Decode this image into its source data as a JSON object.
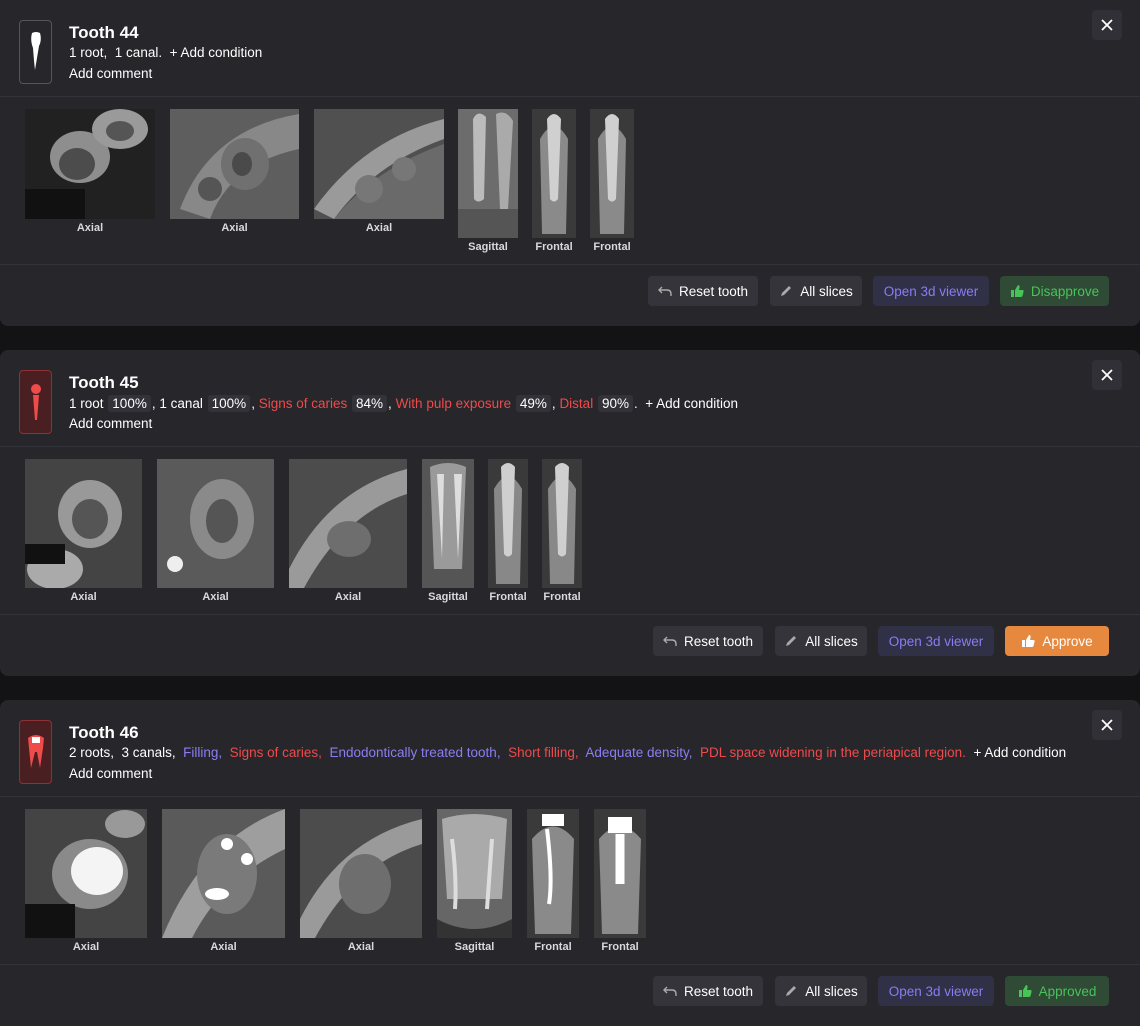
{
  "teeth": [
    {
      "title": "Tooth 44",
      "conditions_prefix": [
        {
          "text": "1 root,",
          "color": "white"
        },
        {
          "text": "1 canal.",
          "color": "white"
        }
      ],
      "add_condition": "+ Add condition",
      "add_comment": "Add comment",
      "slice_labels": [
        "Axial",
        "Axial",
        "Axial",
        "Sagittal",
        "Frontal",
        "Frontal"
      ],
      "buttons": {
        "reset": "Reset tooth",
        "all_slices": "All slices",
        "viewer": "Open 3d viewer",
        "status": "Disapprove"
      }
    },
    {
      "title": "Tooth 45",
      "conditions": [
        {
          "text": "1 root",
          "pct": "100%",
          "color": "white"
        },
        {
          "text": "1 canal",
          "pct": "100%",
          "color": "white"
        },
        {
          "text": "Signs of caries",
          "pct": "84%",
          "color": "red"
        },
        {
          "text": "With pulp exposure",
          "pct": "49%",
          "color": "red"
        },
        {
          "text": "Distal",
          "pct": "90%",
          "color": "red"
        }
      ],
      "add_condition": "+ Add condition",
      "add_comment": "Add comment",
      "slice_labels": [
        "Axial",
        "Axial",
        "Axial",
        "Sagittal",
        "Frontal",
        "Frontal"
      ],
      "buttons": {
        "reset": "Reset tooth",
        "all_slices": "All slices",
        "viewer": "Open 3d viewer",
        "status": "Approve"
      }
    },
    {
      "title": "Tooth 46",
      "conditions": [
        {
          "text": "2 roots,",
          "color": "white"
        },
        {
          "text": "3 canals,",
          "color": "white"
        },
        {
          "text": "Filling,",
          "color": "purple"
        },
        {
          "text": "Signs of caries,",
          "color": "red"
        },
        {
          "text": "Endodontically treated tooth,",
          "color": "purple"
        },
        {
          "text": "Short filling,",
          "color": "red"
        },
        {
          "text": "Adequate density,",
          "color": "purple"
        },
        {
          "text": "PDL space widening in the periapical region.",
          "color": "red"
        }
      ],
      "add_condition": "+ Add condition",
      "add_comment": "Add comment",
      "slice_labels": [
        "Axial",
        "Axial",
        "Axial",
        "Sagittal",
        "Frontal",
        "Frontal"
      ],
      "buttons": {
        "reset": "Reset tooth",
        "all_slices": "All slices",
        "viewer": "Open 3d viewer",
        "status": "Approved"
      }
    }
  ],
  "colors": {
    "red": "#ef4b4b",
    "purple": "#8b7ef2",
    "green": "#49c25a",
    "orange": "#e7883f"
  },
  "icons": [
    "tooth-icon",
    "close-icon",
    "undo-icon",
    "pencil-icon",
    "thumbs-up-icon"
  ]
}
